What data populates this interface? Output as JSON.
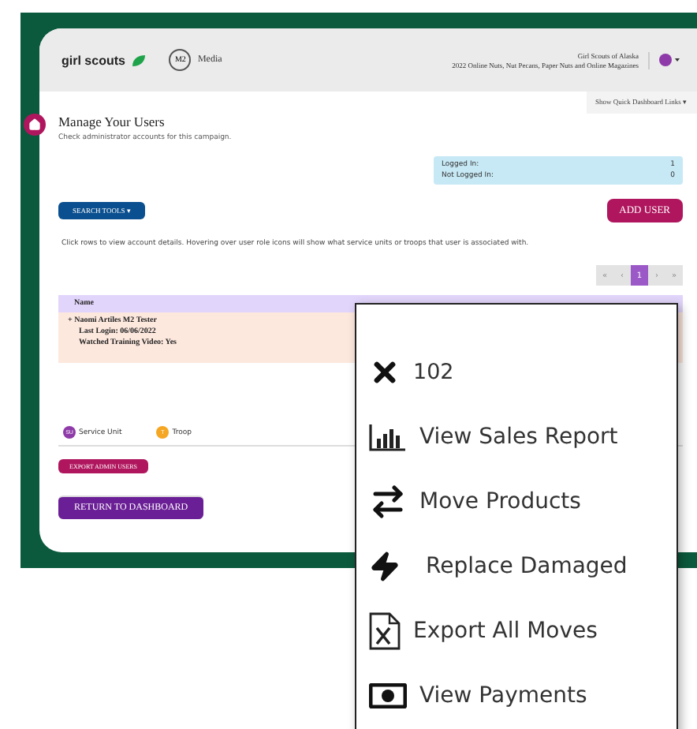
{
  "header": {
    "logo": "girl scouts",
    "partner_badge": "M2",
    "partner": "Media",
    "council": "Girl Scouts of Alaska",
    "campaign": "2022 Online Nuts, Nut Pecans, Paper Nuts and Online Magazines"
  },
  "quick_links": "Show Quick Dashboard Links ▾",
  "page": {
    "title": "Manage Your Users",
    "subtitle": "Check administrator accounts for this campaign."
  },
  "stats": [
    {
      "label": "Logged In:",
      "value": "1"
    },
    {
      "label": "Not Logged In:",
      "value": "0"
    }
  ],
  "search_tools": "SEARCH TOOLS ▾",
  "add_user": "ADD USER",
  "instructions": "Click rows to view account details. Hovering over user role icons will show what service units or troops that user is associated with.",
  "pagination": [
    {
      "label": "«",
      "selected": false
    },
    {
      "label": "‹",
      "selected": false
    },
    {
      "label": "1",
      "selected": true
    },
    {
      "label": "›",
      "selected": false
    },
    {
      "label": "»",
      "selected": false
    }
  ],
  "table": {
    "columns": [
      "Name"
    ],
    "rows": [
      {
        "name": "Naomi Artiles M2 Tester",
        "expand": "+",
        "lines": [
          "Last Login: 06/06/2022",
          "Watched Training Video: Yes"
        ]
      }
    ]
  },
  "legend": [
    {
      "badge": "SU",
      "label": "Service Unit",
      "color": "#8e3aa8"
    },
    {
      "badge": "T",
      "label": "Troop",
      "color": "#f5a623"
    }
  ],
  "export_button": "EXPORT ADMIN USERS",
  "return_button": "RETURN TO DASHBOARD",
  "menu": {
    "title": "102",
    "items": [
      "View Sales Report",
      "Move Products",
      "Replace Damaged",
      "Export All Moves",
      "View Payments"
    ]
  }
}
